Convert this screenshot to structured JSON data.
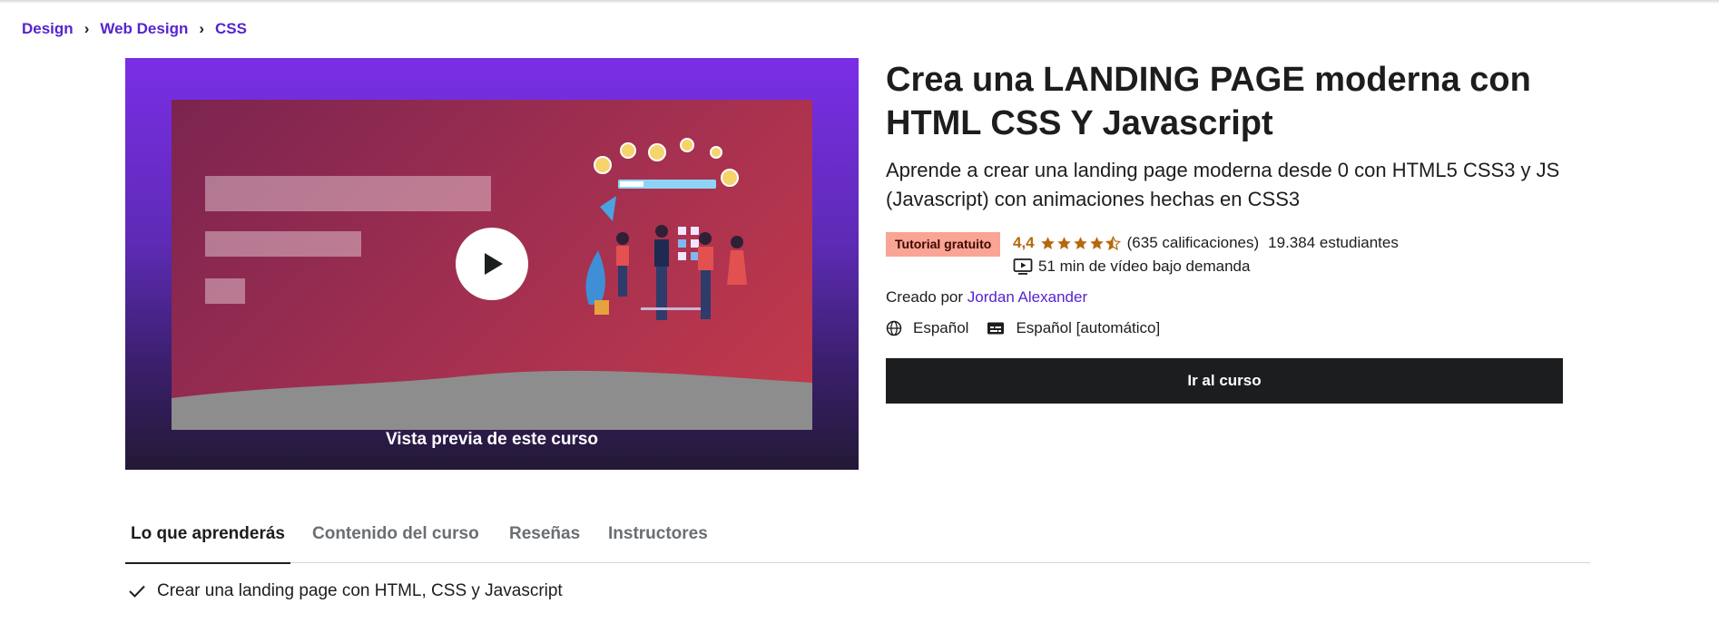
{
  "breadcrumb": {
    "items": [
      "Design",
      "Web Design",
      "CSS"
    ]
  },
  "preview": {
    "label": "Vista previa de este curso",
    "colors": {
      "top": "#7a2ee6",
      "bottom": "#231936",
      "thumb_start": "#7b2450",
      "thumb_end": "#c53a4a"
    }
  },
  "course": {
    "title": "Crea una LANDING PAGE moderna con HTML CSS Y Javascript",
    "subtitle": "Aprende a crear una landing page moderna desde 0 con HTML5 CSS3 y JS (Javascript) con animaciones hechas en CSS3",
    "badge": "Tutorial gratuito",
    "rating": {
      "score": "4,4",
      "stars_value": 4.4,
      "stars_max": 5,
      "count": "(635 calificaciones)"
    },
    "students": "19.384 estudiantes",
    "duration": "51 min de vídeo bajo demanda",
    "creator_prefix": "Creado por",
    "creator_name": "Jordan Alexander",
    "language": "Español",
    "captions": "Español [automático]",
    "cta": "Ir al curso"
  },
  "tabs": [
    {
      "label": "Lo que aprenderás",
      "active": true
    },
    {
      "label": "Contenido del curso",
      "active": false
    },
    {
      "label": "Reseñas",
      "active": false
    },
    {
      "label": "Instructores",
      "active": false
    }
  ],
  "learn": {
    "items": [
      "Crear una landing page con HTML, CSS y Javascript"
    ]
  },
  "colors": {
    "accent": "#5624d0",
    "star": "#b4690e",
    "badge_bg": "#f9a495",
    "cta_bg": "#1c1d1f"
  },
  "icons": {
    "separator": "chevron-right-icon",
    "play": "play-icon",
    "video": "video-icon",
    "globe": "globe-icon",
    "captions": "closed-captions-icon",
    "check": "check-icon",
    "star": "star-icon"
  }
}
